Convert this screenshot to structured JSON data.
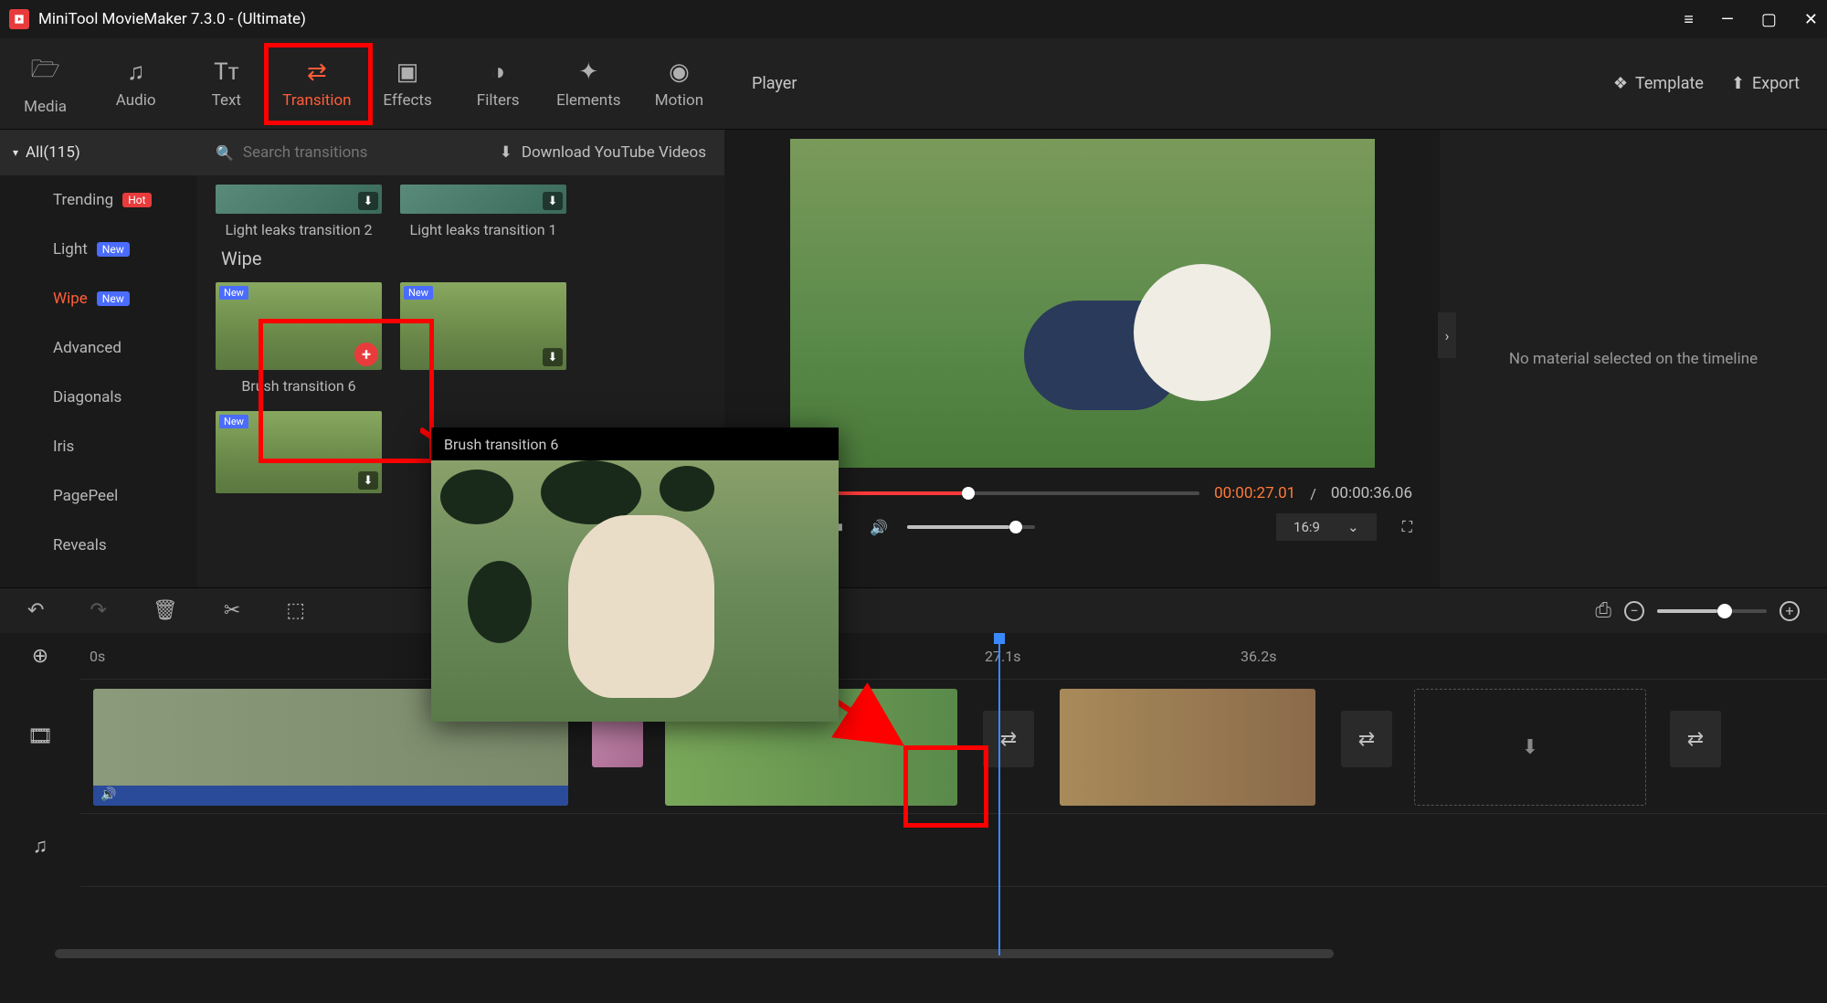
{
  "window": {
    "title": "MiniTool MovieMaker 7.3.0 - (Ultimate)"
  },
  "toolbar": {
    "tabs": [
      {
        "label": "Media"
      },
      {
        "label": "Audio"
      },
      {
        "label": "Text"
      },
      {
        "label": "Transition"
      },
      {
        "label": "Effects"
      },
      {
        "label": "Filters"
      },
      {
        "label": "Elements"
      },
      {
        "label": "Motion"
      }
    ]
  },
  "player": {
    "title": "Player",
    "template": "Template",
    "export": "Export",
    "current_time": "00:00:27.01",
    "duration": "00:00:36.06",
    "aspect": "16:9"
  },
  "categories": {
    "header": "All(115)",
    "items": [
      {
        "label": "Trending",
        "badge": "Hot",
        "badgeClass": "hot"
      },
      {
        "label": "Light",
        "badge": "New",
        "badgeClass": "new"
      },
      {
        "label": "Wipe",
        "badge": "New",
        "badgeClass": "new",
        "active": true
      },
      {
        "label": "Advanced"
      },
      {
        "label": "Diagonals"
      },
      {
        "label": "Iris"
      },
      {
        "label": "PagePeel"
      },
      {
        "label": "Reveals"
      }
    ]
  },
  "search": {
    "placeholder": "Search transitions"
  },
  "download_link": "Download YouTube Videos",
  "transitions": {
    "row0": [
      {
        "label": "Light leaks transition 2"
      },
      {
        "label": "Light leaks transition 1"
      }
    ],
    "section": "Wipe",
    "row1": [
      {
        "label": "Brush transition 6",
        "badge": "New",
        "selected": true
      },
      {
        "label": "",
        "badge": "New"
      }
    ],
    "row2": [
      {
        "badge": "New"
      }
    ]
  },
  "preview": {
    "title": "Brush transition 6"
  },
  "inspector": {
    "empty": "No material selected on the timeline"
  },
  "timeline": {
    "ruler": [
      "0s",
      "27.1s",
      "36.2s"
    ]
  }
}
